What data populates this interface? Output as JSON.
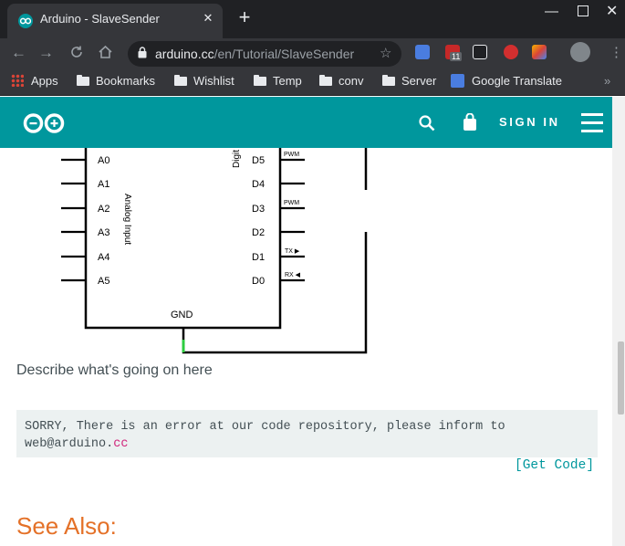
{
  "browser": {
    "tab_title": "Arduino - SlaveSender",
    "tab_close": "✕",
    "new_tab": "+",
    "window_buttons": {
      "minimize": "—",
      "close": "✕"
    },
    "url_host": "arduino.cc",
    "url_path": "/en/Tutorial/SlaveSender",
    "extension_badge": "11",
    "bookmarks": [
      {
        "label": "Apps",
        "icon": "apps-grid-icon"
      },
      {
        "label": "Bookmarks",
        "icon": "folder-icon"
      },
      {
        "label": "Wishlist",
        "icon": "folder-icon"
      },
      {
        "label": "Temp",
        "icon": "folder-icon"
      },
      {
        "label": "conv",
        "icon": "folder-icon"
      },
      {
        "label": "Server",
        "icon": "folder-icon"
      },
      {
        "label": "Google Translate",
        "icon": "google-translate-icon"
      }
    ],
    "bookmarks_overflow": "»"
  },
  "header": {
    "sign_in": "SIGN IN",
    "brand_color": "#00979d"
  },
  "schematic": {
    "left_pins": [
      "A0",
      "A1",
      "A2",
      "A3",
      "A4",
      "A5"
    ],
    "right_pins": [
      "D5",
      "D4",
      "D3",
      "D2",
      "D1",
      "D0"
    ],
    "pin_tags": [
      "PWM",
      "",
      "PWM",
      "",
      "TX ▶",
      "RX ◀"
    ],
    "analog_label": "Analog Input",
    "digital_label": "Digit",
    "gnd_label": "GND"
  },
  "content": {
    "describe": "Describe what's going on here",
    "code_main": "SORRY, There is an error at our code repository, please inform to web@arduino.",
    "code_tld": "cc",
    "get_code": "[Get Code]",
    "see_also": "See Also:"
  },
  "colors": {
    "accent": "#00979d",
    "heading": "#e47128",
    "code_highlight": "#d0237a",
    "text": "#434f54"
  }
}
